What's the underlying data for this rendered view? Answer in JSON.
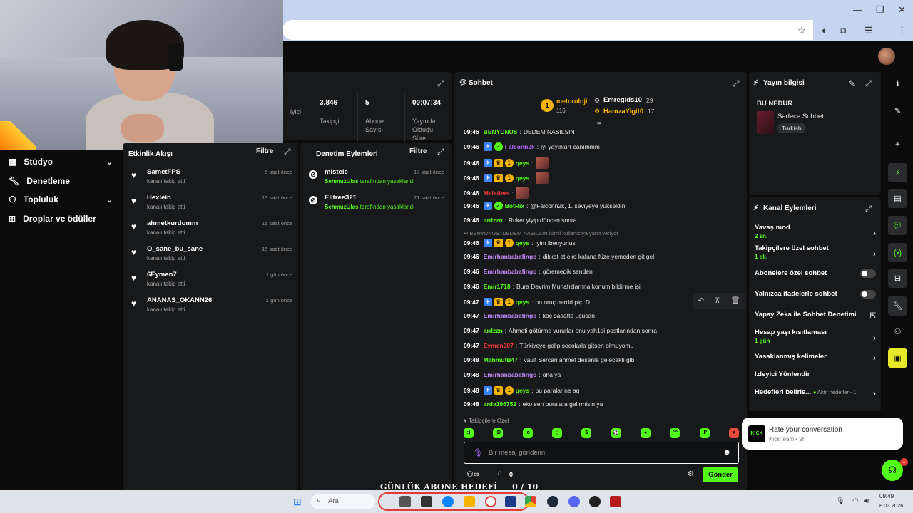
{
  "browser": {
    "min": "—",
    "max": "❐",
    "close": "✕"
  },
  "leftnav": [
    {
      "label": "Stüdyo",
      "icon": "studio-icon",
      "chev": "⌄"
    },
    {
      "label": "Denetleme",
      "icon": "wrench-icon"
    },
    {
      "label": "Topluluk",
      "icon": "community-icon",
      "chev": "⌄"
    },
    {
      "label": "Droplar ve ödüller",
      "icon": "drops-icon"
    }
  ],
  "stats": [
    {
      "value": "",
      "label": "iyici"
    },
    {
      "value": "3.846",
      "label": "Takipçi"
    },
    {
      "value": "5",
      "label": "Abone Sayısı"
    },
    {
      "value": "00:07:34",
      "label": "Yayında Olduğu Süre"
    }
  ],
  "activity": {
    "title": "Etkinlik Akışı",
    "filter": "Filtre",
    "items": [
      {
        "name": "SametFPS",
        "sub": "kanalı takip etti",
        "time": "5 saat önce"
      },
      {
        "name": "Hexlein",
        "sub": "kanalı takip etti",
        "time": "13 saat önce"
      },
      {
        "name": "ahmetkurdomm",
        "sub": "kanalı takip etti",
        "time": "15 saat önce"
      },
      {
        "name": "O_sane_bu_sane",
        "sub": "kanalı takip etti",
        "time": "15 saat önce"
      },
      {
        "name": "6Eymen7",
        "sub": "kanalı takip etti",
        "time": "1 gün önce"
      },
      {
        "name": "ANANAS_OKANN26",
        "sub": "kanalı takip etti",
        "time": "1 gün önce"
      }
    ]
  },
  "moderation": {
    "title": "Denetim Eylemleri",
    "filter": "Filtre",
    "items": [
      {
        "name": "mistele",
        "sub_user": "SehmuzUlas",
        "sub_rest": " tarafından yasaklandı",
        "time": "17 saat önce"
      },
      {
        "name": "Elitree321",
        "sub_user": "SehmuzUlas",
        "sub_rest": " tarafından yasaklandı",
        "time": "21 saat önce"
      }
    ]
  },
  "chat": {
    "title": "Sohbet",
    "leaders": [
      {
        "rank": "1",
        "name": "metoroloji",
        "count": "116"
      },
      {
        "name": "Emregids10",
        "count": "29"
      },
      {
        "name": "HamzaYigit0",
        "count": "17"
      }
    ],
    "messages": [
      {
        "time": "09:46",
        "user": "BENYUNUS",
        "color": "#53fc18",
        "badges": [],
        "text": "DEDEM NASILSIN"
      },
      {
        "time": "09:46",
        "user": "Falconn2k",
        "color": "#b06cff",
        "badges": [
          "a",
          "v"
        ],
        "text": "iyi yayınlarr canımmm"
      },
      {
        "time": "09:46",
        "user": "qeys",
        "color": "#53fc18",
        "badges": [
          "a",
          "c",
          "1"
        ],
        "text": "",
        "emote": true
      },
      {
        "time": "09:46",
        "user": "qeys",
        "color": "#53fc18",
        "badges": [
          "a",
          "c",
          "1"
        ],
        "text": "",
        "emote": true
      },
      {
        "time": "09:46",
        "user": "Meistiers",
        "color": "#ff3a3a",
        "badges": [],
        "text": "",
        "emote": true
      },
      {
        "time": "09:46",
        "user": "BotRix",
        "color": "#53fc18",
        "badges": [
          "a",
          "v"
        ],
        "text": "@Falconn2k, 1. seviyeye yükseldin."
      },
      {
        "time": "09:46",
        "user": "ardzzn",
        "color": "#53fc18",
        "badges": [],
        "text": "Roket yiyip döncen sonra"
      },
      {
        "time": "09:46",
        "user": "qeys",
        "color": "#53fc18",
        "badges": [
          "a",
          "c",
          "1"
        ],
        "text": "iyim ibenyunus"
      },
      {
        "time": "09:46",
        "user": "Emirhanbabafingo",
        "color": "#c68cff",
        "badges": [],
        "text": "dikkat et eko kafana füze yemeden git gel"
      },
      {
        "time": "09:46",
        "user": "Emirhanbabafingo",
        "color": "#c68cff",
        "badges": [],
        "text": "göremedik senden"
      },
      {
        "time": "09:46",
        "user": "Emir1718",
        "color": "#53fc18",
        "badges": [],
        "text": "Bura Devrim Muhafızlarnna konum bildirme işi"
      },
      {
        "time": "09:47",
        "user": "qeys",
        "color": "#53fc18",
        "badges": [
          "a",
          "c",
          "1"
        ],
        "text": "oo oruç nerdd piç :D"
      },
      {
        "time": "09:47",
        "user": "Emirhanbabafingo",
        "color": "#c68cff",
        "badges": [],
        "text": "kaç saaatte uçucan"
      },
      {
        "time": "09:47",
        "user": "ardzzn",
        "color": "#53fc18",
        "badges": [],
        "text": "Ahmeti götürme vururlar onu yah1di postlarından sonra"
      },
      {
        "time": "09:47",
        "user": "Eymen007",
        "color": "#ff3a3a",
        "badges": [],
        "text": "Türkiyeye gelip secolarla gitsen olmuyomu"
      },
      {
        "time": "09:48",
        "user": "MahmutB47",
        "color": "#53fc18",
        "badges": [],
        "text": "vault Sercan ahmet desenle gelecekti glb"
      },
      {
        "time": "09:48",
        "user": "Emirhanbabafingo",
        "color": "#c68cff",
        "badges": [],
        "text": "oha ya"
      },
      {
        "time": "09:48",
        "user": "qeys",
        "color": "#53fc18",
        "badges": [
          "a",
          "c",
          "1"
        ],
        "text": "bu paralar ne aq"
      },
      {
        "time": "09:48",
        "user": "arda196752",
        "color": "#53fc18",
        "badges": [],
        "text": "eko sen buralara gelirmisin ya"
      }
    ],
    "reply_note": "BENYUNUS: DEDEM NASILSIN isimli kullanıcıya yanıt veriyor",
    "followers_only": "Takipçilere Özel",
    "placeholder": "Bir mesaj gönderin",
    "send": "Gönder",
    "bottom_count": "0"
  },
  "streaminfo": {
    "title": "Yayın bilgisi",
    "stream_title": "BU NEDUR",
    "category": "Sadece Sohbet",
    "tag": "Turkish"
  },
  "channel_actions": {
    "title": "Kanal Eylemleri",
    "rows": [
      {
        "label": "Yavaş mod",
        "sub": "2 sn.",
        "type": "arrow"
      },
      {
        "label": "Takipçilere özel sohbet",
        "sub": "1 dk.",
        "type": "arrow"
      },
      {
        "label": "Abonelere özel sohbet",
        "type": "toggle"
      },
      {
        "label": "Yalnızca ifadelerle sohbet",
        "type": "toggle"
      },
      {
        "label": "Yapay Zeka ile Sohbet Denetimi",
        "type": "ext"
      },
      {
        "label": "Hesap yaşı kısıtlaması",
        "sub": "1 gün",
        "type": "arrow"
      },
      {
        "label": "Yasaklanmış kelimeler",
        "type": "arrow"
      },
      {
        "label": "İzleyici Yönlendir",
        "type": "none"
      },
      {
        "label": "Hedefleri belirle...",
        "extra": "Aktif hedefler - 1",
        "type": "arrow"
      }
    ]
  },
  "toast": {
    "brand": "KICK",
    "title": "Rate your conversation",
    "sub": "Kick team • 9h"
  },
  "goal": {
    "label": "GÜNLÜK ABONE HEDEFİ",
    "progress": "0 / 10"
  },
  "taskbar": {
    "search": "Ara",
    "time": "09:49",
    "date": "8.03.2026"
  },
  "colors": {
    "accent": "#53fc18",
    "panel": "#18191b"
  }
}
